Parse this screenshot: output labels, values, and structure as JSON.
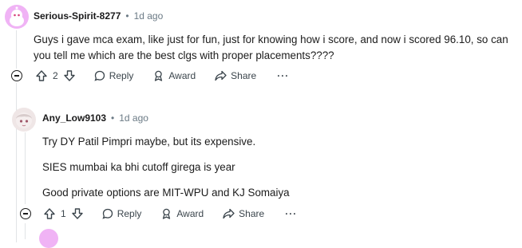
{
  "comments": [
    {
      "username": "Serious-Spirit-8277",
      "separator": "•",
      "time": "1d ago",
      "paragraphs": [
        "Guys i gave mca exam, like just for fun, just for knowing how i score, and now i scored 96.10, so can you tell me which are the best clgs with proper placements????"
      ],
      "votes": "2",
      "reply_label": "Reply",
      "award_label": "Award",
      "share_label": "Share",
      "more_label": "···"
    },
    {
      "username": "Any_Low9103",
      "separator": "•",
      "time": "1d ago",
      "paragraphs": [
        "Try DY Patil Pimpri maybe, but its expensive.",
        "SIES mumbai ka bhi cutoff girega is year",
        "Good private options are MIT-WPU and KJ Somaiya"
      ],
      "votes": "1",
      "reply_label": "Reply",
      "award_label": "Award",
      "share_label": "Share",
      "more_label": "···"
    }
  ],
  "colors": {
    "avatar1": "#f0b3f5",
    "thread_line": "#e1e4e6",
    "muted_text": "#6b7a85"
  },
  "icons": [
    "collapse-icon",
    "upvote-icon",
    "downvote-icon",
    "reply-icon",
    "award-icon",
    "share-icon",
    "more-icon"
  ]
}
